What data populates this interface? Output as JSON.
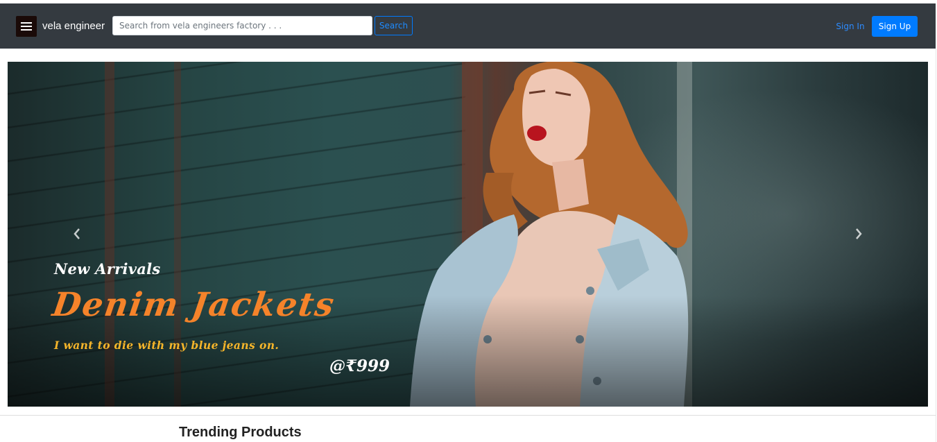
{
  "navbar": {
    "brand": "vela engineer",
    "search": {
      "placeholder": "Search from vela engineers factory . . .",
      "value": ""
    },
    "search_label": "Search",
    "signin_label": "Sign In",
    "signup_label": "Sign Up"
  },
  "colors": {
    "navbar_bg": "#343a40",
    "primary": "#007bff",
    "caption_title": "#f5832a",
    "caption_tagline": "#f5b52a"
  },
  "icons": {
    "menu": "hamburger-icon",
    "prev": "chevron-left-icon",
    "next": "chevron-right-icon"
  },
  "carousel": {
    "kicker": "New Arrivals",
    "title": "Denim Jackets",
    "tagline": "I want to die with my blue jeans on.",
    "price": "@₹999"
  },
  "sections": {
    "trending_title": "Trending Products"
  }
}
